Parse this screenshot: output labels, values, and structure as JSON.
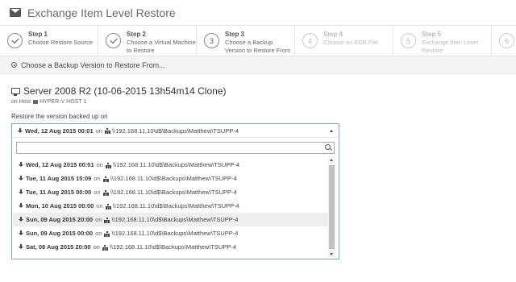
{
  "window": {
    "title": "Exchange Item Level Restore"
  },
  "steps": [
    {
      "num": "",
      "label": "Step 1",
      "desc": "Choose Restore Source",
      "state": "done"
    },
    {
      "num": "",
      "label": "Step 2",
      "desc": "Choose a Virtual Machine to Restore",
      "state": "done"
    },
    {
      "num": "3",
      "label": "Step 3",
      "desc": "Choose a Backup Version to Restore From",
      "state": "current"
    },
    {
      "num": "4",
      "label": "Step 4",
      "desc": "Choose an EDB File",
      "state": "future"
    },
    {
      "num": "5",
      "label": "Step 5",
      "desc": "Exchange Item Level Restore",
      "state": "future"
    },
    {
      "num": "6",
      "label": "",
      "desc": "",
      "state": "future"
    }
  ],
  "subheader": {
    "text": "Choose a Backup Version to Restore From..."
  },
  "server": {
    "name": "Server 2008 R2 (10-06-2015 13h54m14 Clone)",
    "host_prefix": "on Host",
    "host_name": "HYPER-V HOST 1"
  },
  "restore_label": "Restore the version backed up on",
  "dropdown": {
    "selected": {
      "date": "Wed, 12 Aug 2015 00:01",
      "on": "on",
      "path": "\\\\192.168.11.10\\d$\\Backups\\Matthew\\TSUPP-4"
    },
    "search_placeholder": "",
    "options": [
      {
        "date": "Wed, 12 Aug 2015 00:01",
        "on": "on",
        "path": "\\\\192.168.11.10\\d$\\Backups\\Matthew\\TSUPP-4",
        "hover": false
      },
      {
        "date": "Tue, 11 Aug 2015 15:09",
        "on": "on",
        "path": "\\\\192.168.11.10\\d$\\Backups\\Matthew\\TSUPP-4",
        "hover": false
      },
      {
        "date": "Tue, 11 Aug 2015 00:00",
        "on": "on",
        "path": "\\\\192.168.11.10\\d$\\Backups\\Matthew\\TSUPP-4",
        "hover": false
      },
      {
        "date": "Mon, 10 Aug 2015 00:00",
        "on": "on",
        "path": "\\\\192.168.11.10\\d$\\Backups\\Matthew\\TSUPP-4",
        "hover": false
      },
      {
        "date": "Sun, 09 Aug 2015 20:00",
        "on": "on",
        "path": "\\\\192.168.11.10\\d$\\Backups\\Matthew\\TSUPP-4",
        "hover": true
      },
      {
        "date": "Sun, 09 Aug 2015 00:00",
        "on": "on",
        "path": "\\\\192.168.11.10\\d$\\Backups\\Matthew\\TSUPP-4",
        "hover": false
      },
      {
        "date": "Sat, 08 Aug 2015 20:00",
        "on": "on",
        "path": "\\\\192.168.11.10\\d$\\Backups\\Matthew\\TSUPP-4",
        "hover": false
      }
    ]
  },
  "colors": {
    "accent_border": "#7aa9d8",
    "hover_row": "#eeeeee"
  }
}
